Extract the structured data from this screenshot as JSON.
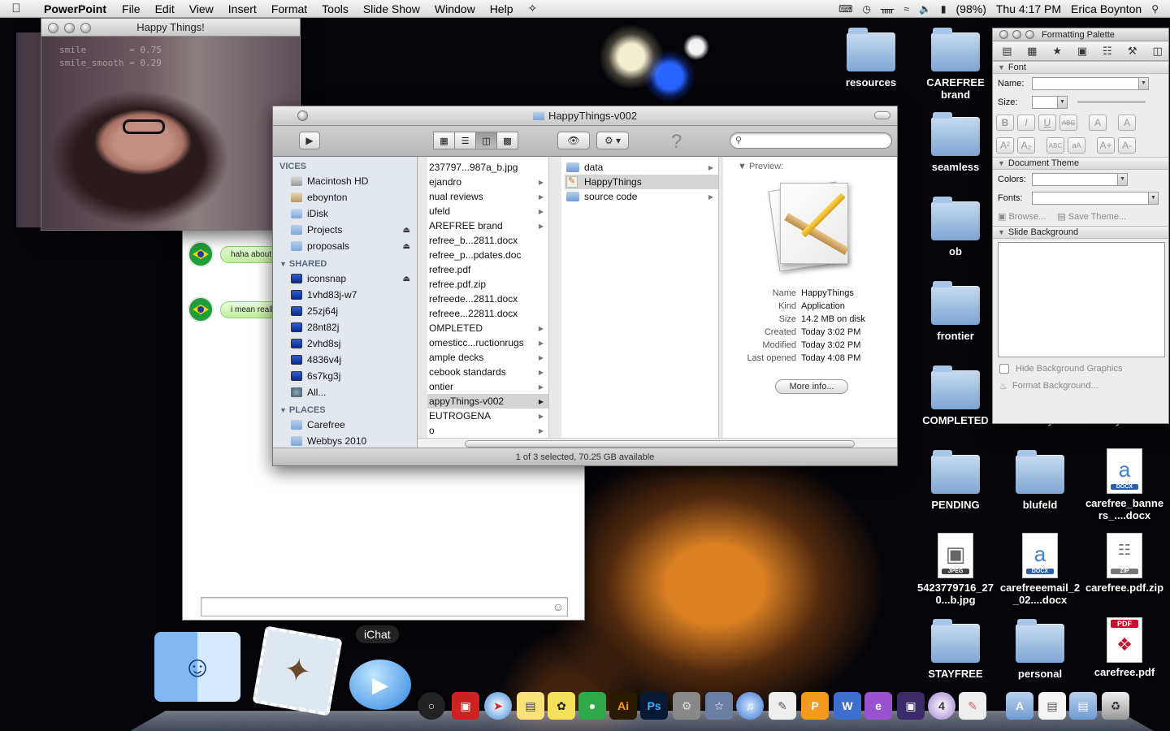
{
  "menubar": {
    "app_name": "PowerPoint",
    "menus": [
      "File",
      "Edit",
      "View",
      "Insert",
      "Format",
      "Tools",
      "Slide Show",
      "Window",
      "Help"
    ],
    "battery_percent": "(98%)",
    "clock": "Thu 4:17 PM",
    "user": "Erica Boynton"
  },
  "webcam": {
    "title": "Happy Things!",
    "line1": "smile        = 0.75",
    "line2": "smile_smooth = 0.29"
  },
  "chat": {
    "msg1": "haha about",
    "msg2": "i mean reall"
  },
  "finder": {
    "title": "HappyThings-v002",
    "sidebar": {
      "devices_header": "VICES",
      "devices": [
        {
          "label": "Macintosh HD",
          "icon": "disk-icon"
        },
        {
          "label": "eboynton",
          "icon": "home-icon"
        },
        {
          "label": "iDisk",
          "icon": "idisk-icon"
        },
        {
          "label": "Projects",
          "icon": "folder-icon",
          "eject": true
        },
        {
          "label": "proposals",
          "icon": "folder-icon",
          "eject": true
        }
      ],
      "shared_header": "SHARED",
      "shared": [
        {
          "label": "iconsnap",
          "eject": true
        },
        {
          "label": "1vhd83j-w7"
        },
        {
          "label": "25zj64j"
        },
        {
          "label": "28nt82j"
        },
        {
          "label": "2vhd8sj"
        },
        {
          "label": "4836v4j"
        },
        {
          "label": "6s7kg3j"
        },
        {
          "label": "All..."
        }
      ],
      "places_header": "PLACES",
      "places": [
        {
          "label": "Carefree"
        },
        {
          "label": "Webbys 2010"
        }
      ]
    },
    "column1": [
      "237797...987a_b.jpg",
      "ejandro",
      "nual reviews",
      "ufeld",
      "AREFREE brand",
      "refree_b...2811.docx",
      "refree_p...pdates.doc",
      "refree.pdf",
      "refree.pdf.zip",
      "refreede...2811.docx",
      "refreee...22811.docx",
      "OMPLETED",
      "omesticc...ructionrugs",
      "ample decks",
      "cebook standards",
      "ontier",
      "appyThings-v002",
      "EUTROGENA",
      "o"
    ],
    "column2": [
      {
        "label": "data",
        "type": "folder"
      },
      {
        "label": "HappyThings",
        "type": "app"
      },
      {
        "label": "source code",
        "type": "folder"
      }
    ],
    "preview": {
      "label": "Preview:",
      "meta": [
        {
          "k": "Name",
          "v": "HappyThings"
        },
        {
          "k": "Kind",
          "v": "Application"
        },
        {
          "k": "Size",
          "v": "14.2 MB on disk"
        },
        {
          "k": "Created",
          "v": "Today 3:02 PM"
        },
        {
          "k": "Modified",
          "v": "Today 3:02 PM"
        },
        {
          "k": "Last opened",
          "v": "Today 4:08 PM"
        }
      ],
      "more_info": "More info..."
    },
    "status": "1 of 3 selected, 70.25 GB available"
  },
  "palette": {
    "title": "Formatting Palette",
    "font_section": "Font",
    "name_label": "Name:",
    "size_label": "Size:",
    "doc_theme_section": "Document Theme",
    "colors_label": "Colors:",
    "fonts_label": "Fonts:",
    "browse": "Browse...",
    "save_theme": "Save Theme...",
    "slide_bg_section": "Slide Background",
    "hide_bg": "Hide Background Graphics",
    "format_bg": "Format Background..."
  },
  "desktop": {
    "resources": "resources",
    "carefree_brand": "CAREFREE brand",
    "seamless": "seamless",
    "ob": "ob",
    "frontier": "frontier",
    "completed": "COMPLETED",
    "webbys": "webbys",
    "webbyevolved": "webbyevolved",
    "pending": "PENDING",
    "blufeld": "blufeld",
    "carefree_banners": "carefree_banners_....docx",
    "jpeg_file": "5423779716_270...b.jpg",
    "carefreeemail": "carefreeemail_2_02....docx",
    "carefree_zip": "carefree.pdf.zip",
    "stayfree": "STAYFREE",
    "personal": "personal",
    "carefree_pdf": "carefree.pdf",
    "jpeg_tag": "JPEG",
    "docx_tag": "DOCX",
    "zip_tag": "ZIP",
    "pdf_tag": "PDF"
  },
  "dock": {
    "ichat_label": "iChat",
    "ai": "Ai",
    "ps": "Ps"
  }
}
